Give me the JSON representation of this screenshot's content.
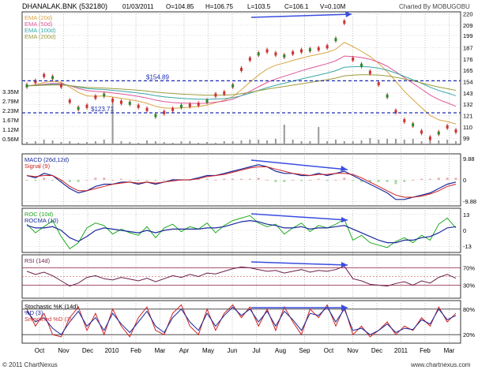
{
  "header": {
    "symbol": "DHANALAK.BNK (532180)",
    "date": "01/03/2011",
    "open": "O=104.85",
    "high": "H=106.75",
    "low": "L=103.5",
    "close": "C=106.1",
    "volume": "V=0.10M",
    "brand": "Charted By MOBUGOBU"
  },
  "footer": {
    "left": "© 2011 ChartNexus",
    "right": "www.chartnexus.com"
  },
  "x_labels": [
    "Oct",
    "Nov",
    "Dec",
    "2010",
    "Feb",
    "Mar",
    "Apr",
    "May",
    "Jun",
    "Jul",
    "Aug",
    "Sep",
    "Oct",
    "Nov",
    "Dec",
    "2011",
    "Feb",
    "Mar"
  ],
  "chart_data": [
    {
      "type": "line",
      "panel": "price",
      "legend": [
        "EMA (20d)",
        "EMA (50d)",
        "EMA (100d)",
        "EMA (200d)"
      ],
      "colors": {
        "price": "#cc3333",
        "ema20": "#d9a441",
        "ema50": "#e0569a",
        "ema100": "#3aa6a6",
        "ema200": "#9c9c3c",
        "support": "#1f2fb5",
        "trend": "#3a4de0"
      },
      "support_lines": [
        {
          "value": 154.89,
          "label": "$154.89"
        },
        {
          "value": 123.71,
          "label": "$123.71"
        }
      ],
      "y_ticks": [
        220,
        209,
        199,
        187,
        176,
        165,
        154,
        143,
        132,
        121,
        110,
        99
      ],
      "ylim": [
        93,
        222
      ],
      "close": [
        150,
        154,
        160,
        158,
        150,
        135,
        128,
        130,
        139,
        141,
        136,
        134,
        133,
        130,
        127,
        121,
        124,
        127,
        130,
        131,
        132,
        135,
        141,
        143,
        150,
        166,
        176,
        181,
        184,
        181,
        179,
        182,
        184,
        185,
        186,
        188,
        195,
        212,
        176,
        170,
        163,
        152,
        140,
        125,
        116,
        112,
        105,
        99,
        104,
        110,
        106
      ]
    },
    {
      "type": "bar",
      "panel": "volume",
      "y_ticks": [
        "3.35M",
        "2.79M",
        "2.23M",
        "1.67M",
        "1.12M",
        "0.56M"
      ],
      "values": [
        0.15,
        0.2,
        0.3,
        0.25,
        0.15,
        0.2,
        0.1,
        0.15,
        0.2,
        0.3,
        2.9,
        0.2,
        0.15,
        0.1,
        0.25,
        0.2,
        0.15,
        0.1,
        0.2,
        0.2,
        0.1,
        0.15,
        0.1,
        0.2,
        0.2,
        0.25,
        0.3,
        0.3,
        0.25,
        0.35,
        1.25,
        0.3,
        0.2,
        0.2,
        1.1,
        0.2,
        0.3,
        0.2,
        0.2,
        0.25,
        0.4,
        0.3,
        0.35,
        0.35,
        0.3,
        0.35,
        0.2,
        0.3,
        0.25,
        0.3,
        0.2
      ]
    },
    {
      "type": "line",
      "panel": "macd",
      "legend": [
        "MACD (26d,12d)",
        "Signal (9)"
      ],
      "colors": {
        "macd": "#1a2a9c",
        "signal": "#cc2222"
      },
      "y_ticks": [
        "9.88",
        "0",
        "-9.88"
      ],
      "ylim": [
        -12,
        12
      ],
      "macd": [
        2,
        1,
        3,
        2,
        -1,
        -4,
        -6,
        -5,
        -3,
        -2,
        -2,
        -1,
        -1,
        -2,
        -1,
        -2,
        -1,
        0,
        0,
        0,
        1,
        2,
        2,
        3,
        4,
        5,
        6,
        7,
        6,
        4,
        3,
        3,
        2,
        2,
        3,
        2,
        3,
        4,
        2,
        0,
        -2,
        -4,
        -6,
        -9,
        -9,
        -8,
        -7,
        -6,
        -4,
        -2,
        -1
      ],
      "signal": [
        2,
        1.5,
        2,
        2,
        0,
        -3,
        -5,
        -5,
        -4,
        -3,
        -2,
        -1.5,
        -1,
        -1.5,
        -1,
        -1.5,
        -1,
        -0.5,
        0,
        0,
        0.5,
        1.5,
        2,
        2.5,
        3.5,
        4.5,
        5.5,
        6,
        6,
        5,
        4,
        3,
        2.5,
        2,
        2.5,
        2.5,
        3,
        3,
        2.5,
        1,
        -1,
        -3,
        -5,
        -7,
        -8,
        -8,
        -7.5,
        -6.5,
        -5,
        -3,
        -2
      ]
    },
    {
      "type": "line",
      "panel": "roc",
      "legend": [
        "ROC (10d)",
        "ROCMA (10)"
      ],
      "colors": {
        "roc": "#22aa22",
        "rocma": "#1a2a9c"
      },
      "y_ticks": [
        "13",
        "0",
        "-13"
      ],
      "ylim": [
        -18,
        18
      ],
      "roc": [
        5,
        -2,
        3,
        8,
        -5,
        -15,
        -10,
        2,
        6,
        4,
        -3,
        1,
        -2,
        -4,
        3,
        -6,
        2,
        5,
        -1,
        3,
        1,
        6,
        -2,
        4,
        8,
        10,
        12,
        6,
        3,
        5,
        -3,
        2,
        6,
        -1,
        4,
        2,
        5,
        9,
        -8,
        -4,
        -10,
        -12,
        -14,
        -9,
        -6,
        -10,
        -4,
        -8,
        5,
        10,
        2
      ],
      "rocma": [
        4,
        2,
        2,
        3,
        0,
        -6,
        -9,
        -5,
        0,
        2,
        1,
        0,
        -1,
        -2,
        0,
        -2,
        0,
        1,
        1,
        1,
        1,
        2,
        2,
        3,
        5,
        7,
        8,
        7,
        5,
        4,
        2,
        2,
        3,
        1,
        2,
        2,
        3,
        4,
        1,
        -2,
        -5,
        -8,
        -10,
        -10,
        -8,
        -8,
        -6,
        -5,
        -2,
        2,
        3
      ]
    },
    {
      "type": "line",
      "panel": "rsi",
      "legend": [
        "RSI (14d)"
      ],
      "colors": {
        "rsi": "#6a1f4a",
        "bands": "#8b1a3a"
      },
      "y_ticks": [
        "70%",
        "30%"
      ],
      "ylim": [
        0,
        100
      ],
      "rsi": [
        62,
        55,
        60,
        52,
        40,
        28,
        35,
        48,
        52,
        45,
        42,
        48,
        44,
        40,
        46,
        38,
        45,
        52,
        48,
        55,
        50,
        58,
        56,
        62,
        68,
        72,
        70,
        66,
        62,
        64,
        58,
        62,
        66,
        60,
        64,
        62,
        66,
        74,
        45,
        40,
        32,
        30,
        28,
        34,
        38,
        30,
        40,
        35,
        48,
        55,
        46
      ]
    },
    {
      "type": "line",
      "panel": "stochastic",
      "legend": [
        "Stochastic %K (14d)",
        "%D (3)",
        "Smoothed %D (3)"
      ],
      "colors": {
        "k": "#cc2222",
        "d": "#1a2a9c",
        "smoothed": "#cc3333"
      },
      "y_ticks": [
        "80%",
        "20%"
      ],
      "ylim": [
        0,
        100
      ],
      "k": [
        80,
        40,
        70,
        20,
        15,
        60,
        85,
        30,
        70,
        20,
        80,
        40,
        15,
        60,
        85,
        30,
        20,
        70,
        90,
        40,
        20,
        80,
        30,
        70,
        90,
        60,
        85,
        40,
        80,
        30,
        85,
        50,
        20,
        80,
        60,
        90,
        40,
        85,
        20,
        40,
        15,
        30,
        50,
        20,
        40,
        30,
        60,
        40,
        85,
        50,
        70
      ],
      "d": [
        75,
        50,
        60,
        35,
        20,
        50,
        75,
        40,
        60,
        30,
        70,
        45,
        25,
        50,
        75,
        40,
        25,
        60,
        80,
        50,
        30,
        70,
        40,
        65,
        85,
        65,
        80,
        50,
        75,
        40,
        75,
        55,
        30,
        70,
        65,
        85,
        50,
        80,
        30,
        35,
        20,
        30,
        45,
        25,
        35,
        32,
        55,
        45,
        80,
        55,
        65
      ]
    }
  ]
}
